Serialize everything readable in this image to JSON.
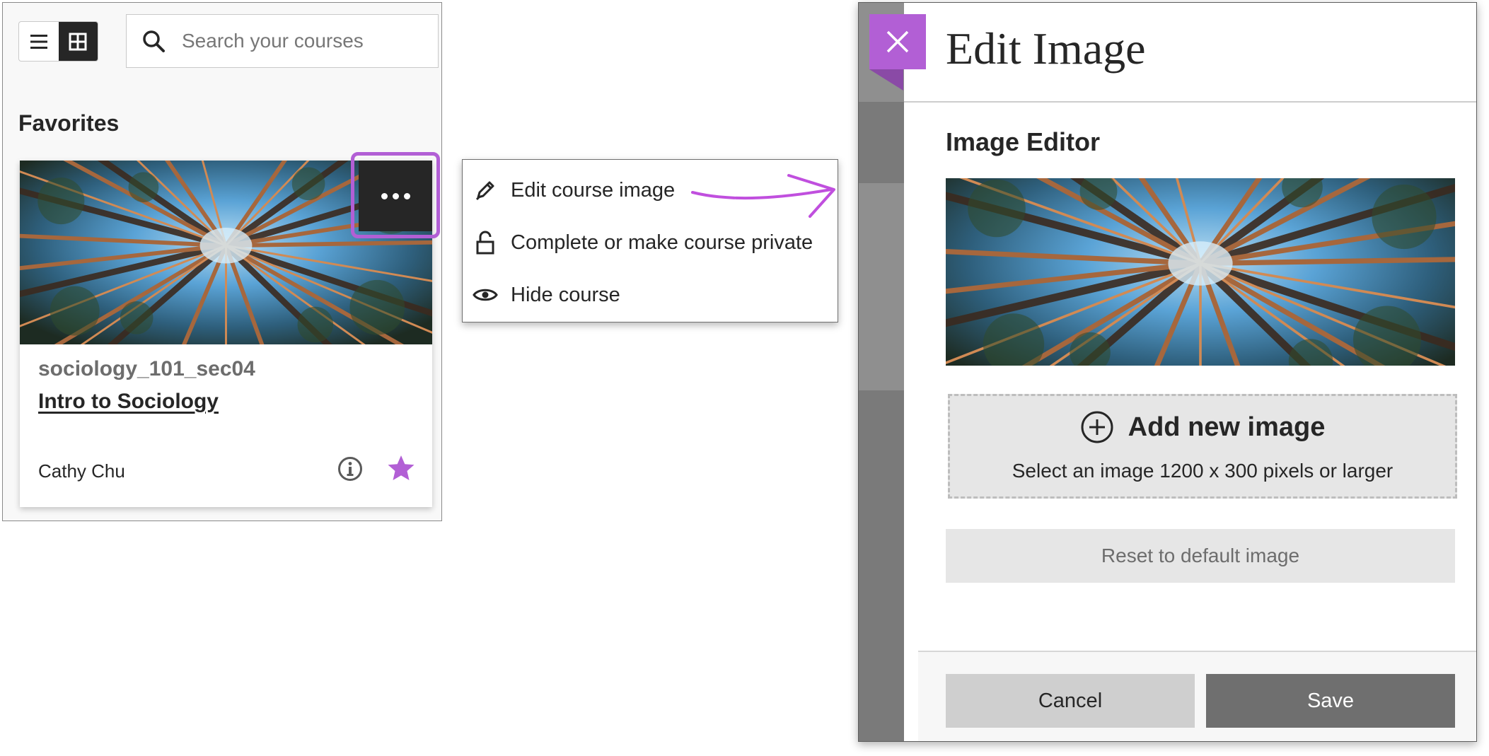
{
  "course_list": {
    "view_toggle": {
      "list_icon": "list-icon",
      "grid_icon": "grid-icon",
      "active": "grid"
    },
    "search": {
      "placeholder": "Search your courses",
      "icon": "search-icon"
    },
    "section_title": "Favorites",
    "card": {
      "image_description_icon": "forest-canopy-image",
      "course_id": "sociology_101_sec04",
      "course_name": "Intro to Sociology",
      "instructor": "Cathy Chu",
      "more_icon": "more-options-icon",
      "info_icon": "info-icon",
      "favorite_icon": "star-icon",
      "favorite": true
    }
  },
  "context_menu": {
    "items": [
      {
        "label": "Edit course image",
        "icon": "pencil-icon"
      },
      {
        "label": "Complete or make course private",
        "icon": "unlock-icon"
      },
      {
        "label": "Hide course",
        "icon": "eye-icon"
      }
    ]
  },
  "edit_panel": {
    "title": "Edit Image",
    "close_icon": "close-icon",
    "section_heading": "Image Editor",
    "add_image": {
      "label": "Add new image",
      "hint": "Select an image 1200 x 300 pixels or larger",
      "icon": "plus-circle-icon"
    },
    "reset_label": "Reset to default image",
    "cancel_label": "Cancel",
    "save_label": "Save"
  },
  "colors": {
    "accent": "#b25fd5",
    "dark": "#262626",
    "save_button": "#6f6f6f",
    "cancel_button": "#cfcfcf",
    "dashed_area": "#e6e6e6"
  }
}
